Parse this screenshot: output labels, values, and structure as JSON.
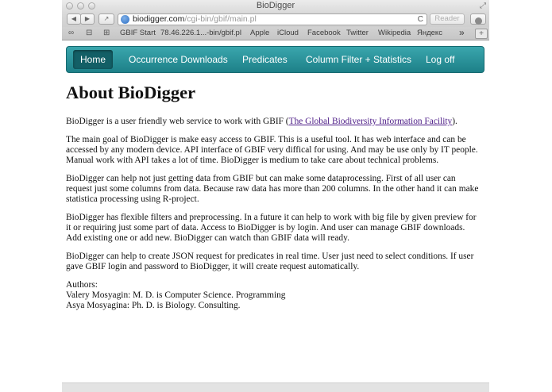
{
  "window": {
    "title": "BioDigger"
  },
  "toolbar": {
    "back_label": "◀",
    "forward_label": "▶",
    "share_label": "↗",
    "url_domain": "biodigger.com",
    "url_path": "/cgi-bin/gbif/main.pl",
    "reload_glyph": "C",
    "reader_label": "Reader"
  },
  "bookmarks": {
    "items": [
      "GBIF Start",
      "78.46.226.1...-bin/gbif.pl",
      "Apple",
      "iCloud",
      "Facebook",
      "Twitter",
      "Wikipedia",
      "Яндекс"
    ],
    "more_glyph": "»",
    "new_tab_glyph": "+"
  },
  "nav": {
    "items": [
      "Home",
      "Occurrence Downloads",
      "Predicates",
      "Column Filter + Statistics",
      "Log off"
    ],
    "active": "Home"
  },
  "content": {
    "title": "About BioDigger",
    "p1_before": "BioDigger is a user friendly web service to work with GBIF (",
    "p1_link": "The Global Biodiversity Information Facility",
    "p1_after": ").",
    "p2": "The main goal of BioDigger is make easy access to GBIF. This is a useful tool. It has web interface and can be accessed by any modern device. API interface of GBIF very diffical for using. And may be use only by IT people. Manual work with API takes a lot of time. BioDigger is medium to take care about technical problems.",
    "p3": "BioDigger can help not just getting data from GBIF but can make some dataprocessing. First of all user can request just some columns from data. Because raw data has more than 200 columns. In the other hand it can make statistica processing using R-project.",
    "p4": "BioDigger has flexible filters and preprocessing. In a future it can help to work with big file by given preview for it or requiring just some part of data. Access to BioDigger is by login. And user can manage GBIF downloads. Add existing one or add new. BioDigger can watch than GBIF data will ready.",
    "p5": "BioDigger can help to create JSON request for predicates in real time. User just need to select conditions. If user gave GBIF login and password to BioDigger, it will create request automatically.",
    "authors_label": "Authors:",
    "authors": [
      "Valery Mosyagin: M. D. is Computer Science. Programming",
      "Asya Mosyagina: Ph. D. is Biology. Consulting."
    ]
  }
}
